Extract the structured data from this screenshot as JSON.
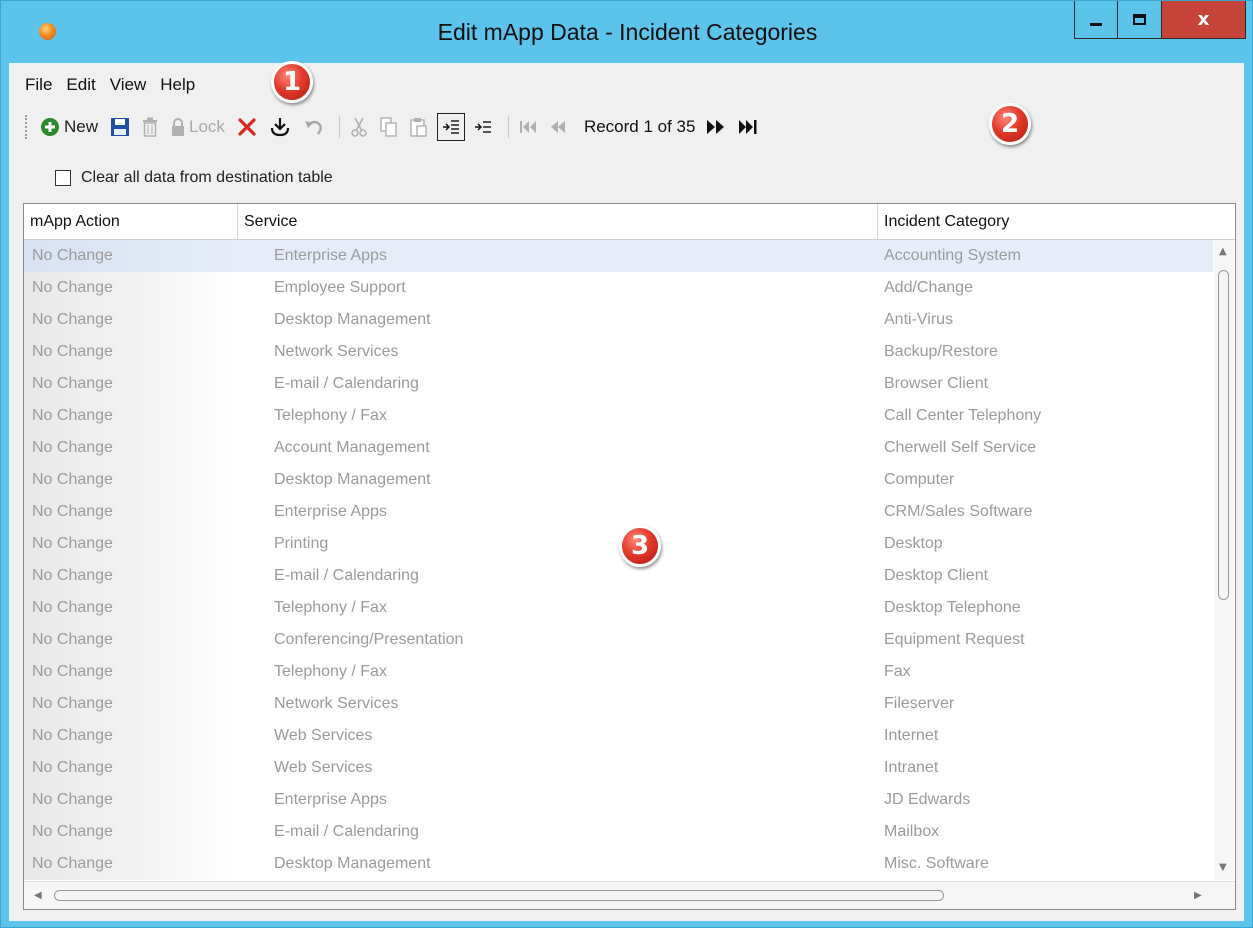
{
  "window": {
    "title": "Edit mApp Data - Incident Categories",
    "controls": {
      "minimize_icon": "minimize-icon",
      "maximize_icon": "maximize-icon",
      "close_label": "x"
    }
  },
  "menu": {
    "items": [
      "File",
      "Edit",
      "View",
      "Help"
    ]
  },
  "callouts": [
    "1",
    "2",
    "3"
  ],
  "toolbar": {
    "new_label": "New",
    "lock_label": "Lock",
    "record_text": "Record 1 of 35",
    "icons": [
      "plus-circle-icon",
      "save-icon",
      "trash-icon",
      "lock-icon",
      "delete-x-icon",
      "import-icon",
      "undo-icon",
      "cut-icon",
      "copy-icon",
      "paste-icon",
      "indent-icon",
      "outdent-icon",
      "first-record-icon",
      "previous-record-icon",
      "next-record-icon",
      "last-record-icon"
    ],
    "colors": {
      "new_green": "#2b8a2b",
      "save_blue": "#1f4fa3",
      "delete_red": "#d8261b"
    }
  },
  "option": {
    "clear_label": "Clear all data from destination table",
    "clear_checked": false
  },
  "grid": {
    "columns": [
      "mApp Action",
      "Service",
      "Incident Category"
    ],
    "rows": [
      [
        "No Change",
        "Enterprise Apps",
        "Accounting System"
      ],
      [
        "No Change",
        "Employee Support",
        "Add/Change"
      ],
      [
        "No Change",
        "Desktop Management",
        "Anti-Virus"
      ],
      [
        "No Change",
        "Network Services",
        "Backup/Restore"
      ],
      [
        "No Change",
        "E-mail / Calendaring",
        "Browser Client"
      ],
      [
        "No Change",
        "Telephony / Fax",
        "Call Center Telephony"
      ],
      [
        "No Change",
        "Account Management",
        "Cherwell Self Service"
      ],
      [
        "No Change",
        "Desktop Management",
        "Computer"
      ],
      [
        "No Change",
        "Enterprise Apps",
        "CRM/Sales Software"
      ],
      [
        "No Change",
        "Printing",
        "Desktop"
      ],
      [
        "No Change",
        "E-mail / Calendaring",
        "Desktop Client"
      ],
      [
        "No Change",
        "Telephony / Fax",
        "Desktop Telephone"
      ],
      [
        "No Change",
        "Conferencing/Presentation",
        "Equipment Request"
      ],
      [
        "No Change",
        "Telephony / Fax",
        "Fax"
      ],
      [
        "No Change",
        "Network Services",
        "Fileserver"
      ],
      [
        "No Change",
        "Web Services",
        "Internet"
      ],
      [
        "No Change",
        "Web Services",
        "Intranet"
      ],
      [
        "No Change",
        "Enterprise Apps",
        "JD Edwards"
      ],
      [
        "No Change",
        "E-mail / Calendaring",
        "Mailbox"
      ],
      [
        "No Change",
        "Desktop Management",
        "Misc. Software"
      ]
    ],
    "selected_row": 0
  }
}
